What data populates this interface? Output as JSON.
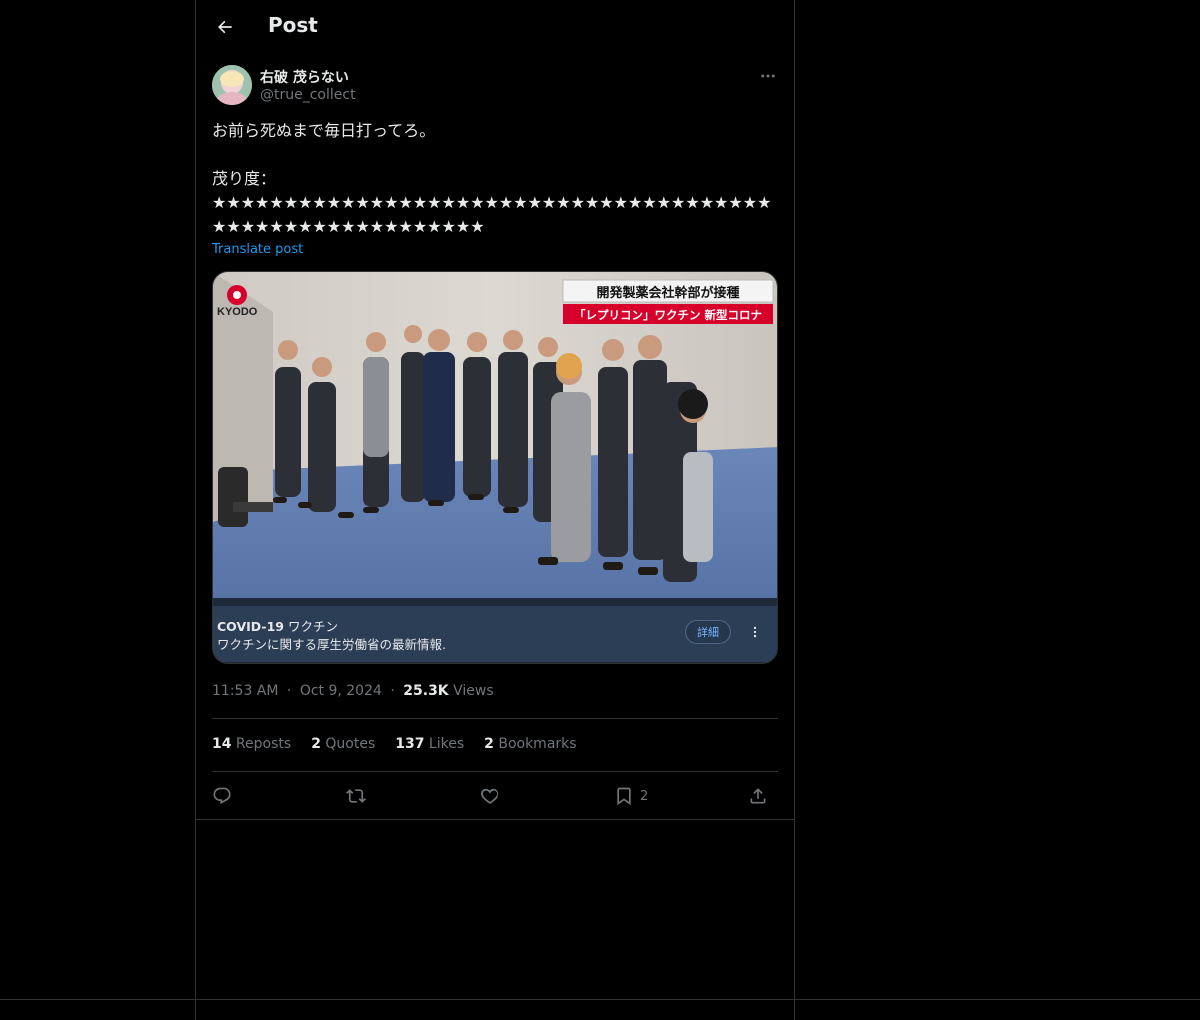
{
  "header": {
    "title": "Post"
  },
  "author": {
    "display_name": "右破 茂らない",
    "handle": "@true_collect"
  },
  "post": {
    "text": "お前ら死ぬまで毎日打ってろ。\n\n茂り度：\n★★★★★★★★★★★★★★★★★★★★★★★★★★★★★★★★★★★★★★★★★★★★★★★★★★★★★★★★★★",
    "translate_label": "Translate post"
  },
  "media": {
    "overlay_caption_line1": "開発製薬会社幹部が接種",
    "overlay_caption_line2": "「レプリコン」ワクチン 新型コロナ",
    "network_logo": "KYODO",
    "notice_title_bold": "COVID-19",
    "notice_title_rest": " ワクチン",
    "notice_subtitle": "ワクチンに関する厚生労働省の最新情報.",
    "notice_button": "詳細"
  },
  "meta": {
    "time": "11:53 AM",
    "separator": "·",
    "date": "Oct 9, 2024",
    "views_count": "25.3K",
    "views_label": " Views"
  },
  "stats": {
    "reposts_count": "14",
    "reposts_label": " Reposts",
    "quotes_count": "2",
    "quotes_label": " Quotes",
    "likes_count": "137",
    "likes_label": " Likes",
    "bookmarks_count": "2",
    "bookmarks_label": " Bookmarks"
  },
  "actions": {
    "reply_icon": "reply-icon",
    "repost_icon": "repost-icon",
    "like_icon": "heart-icon",
    "bookmark_icon": "bookmark-icon",
    "bookmark_count": "2",
    "share_icon": "share-icon"
  },
  "colors": {
    "background": "#000000",
    "text": "#e7e9ea",
    "muted": "#71767b",
    "link": "#1d9bf0",
    "border": "#2f3336"
  }
}
